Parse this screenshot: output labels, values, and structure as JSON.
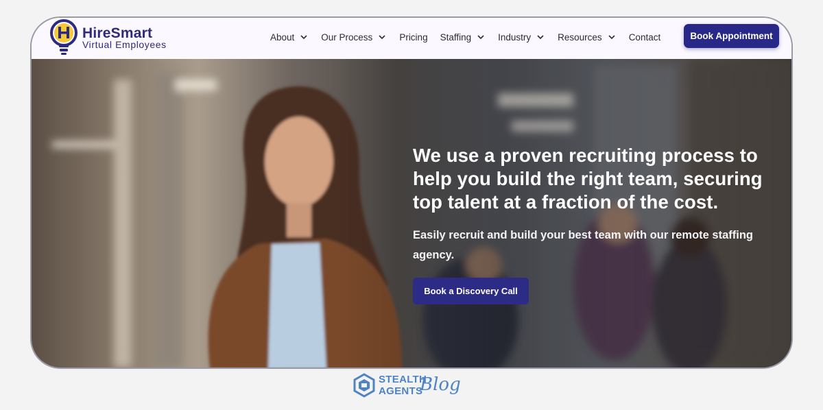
{
  "brand": {
    "name": "HireSmart",
    "tagline": "Virtual Employees",
    "logo_icon": "lightbulb-h-icon",
    "color": "#2e2a7e"
  },
  "nav": {
    "items": [
      {
        "label": "About",
        "has_dropdown": true
      },
      {
        "label": "Our Process",
        "has_dropdown": true
      },
      {
        "label": "Pricing",
        "has_dropdown": false
      },
      {
        "label": "Staffing",
        "has_dropdown": true
      },
      {
        "label": "Industry",
        "has_dropdown": true
      },
      {
        "label": "Resources",
        "has_dropdown": true
      },
      {
        "label": "Contact",
        "has_dropdown": false
      }
    ],
    "book_button": "Book Appointment",
    "accent": "#272887"
  },
  "hero": {
    "title": "We use a proven recruiting process to help you build the right team, securing top talent at a fraction of the cost.",
    "subtitle": "Easily recruit and build your best team with our remote staffing agency.",
    "cta_label": "Book a Discovery Call"
  },
  "footer": {
    "brand_line1": "STEALTH",
    "brand_line2": "AGENTS",
    "brand_script": "Blog",
    "logo_icon": "stealth-agents-hex-icon",
    "color": "#4e83c4"
  }
}
